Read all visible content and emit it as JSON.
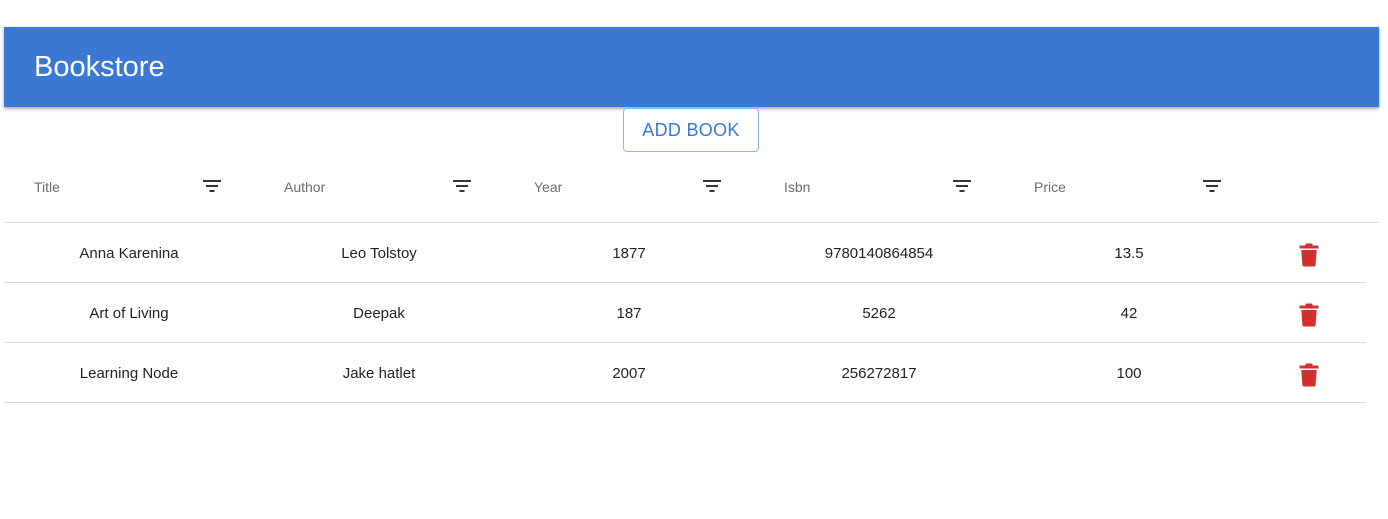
{
  "app": {
    "title": "Bookstore"
  },
  "toolbar": {
    "add_label": "ADD BOOK"
  },
  "table": {
    "columns": [
      {
        "label": "Title",
        "icon": "filter-icon"
      },
      {
        "label": "Author",
        "icon": "filter-icon"
      },
      {
        "label": "Year",
        "icon": "filter-icon"
      },
      {
        "label": "Isbn",
        "icon": "filter-icon"
      },
      {
        "label": "Price",
        "icon": "filter-icon"
      }
    ],
    "rows": [
      {
        "title": "Anna Karenina",
        "author": "Leo Tolstoy",
        "year": "1877",
        "isbn": "9780140864854",
        "price": "13.5",
        "action_icon": "trash-icon"
      },
      {
        "title": "Art of Living",
        "author": "Deepak",
        "year": "187",
        "isbn": "5262",
        "price": "42",
        "action_icon": "trash-icon"
      },
      {
        "title": "Learning Node",
        "author": "Jake hatlet",
        "year": "2007",
        "isbn": "256272817",
        "price": "100",
        "action_icon": "trash-icon"
      }
    ]
  },
  "colors": {
    "primary": "#3b78d4",
    "delete": "#d32f2f",
    "header_text": "#6b6b6b",
    "divider": "#dddddd"
  }
}
